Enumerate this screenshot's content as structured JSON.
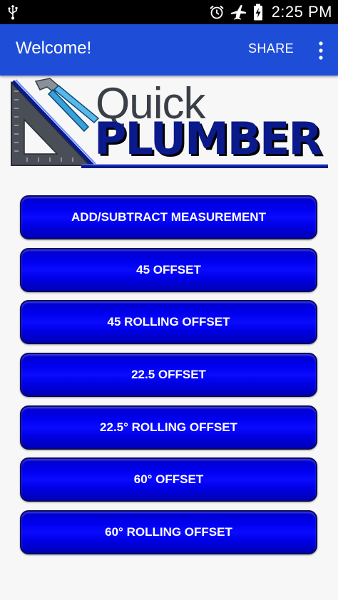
{
  "status_bar": {
    "time": "2:25 PM",
    "icons": [
      "usb-icon",
      "alarm-icon",
      "airplane-mode-icon",
      "battery-charging-icon"
    ]
  },
  "app_bar": {
    "title": "Welcome!",
    "share_label": "SHARE",
    "overflow_icon": "more-vert-icon",
    "color": "#1e4ed8"
  },
  "logo": {
    "line1": "Quick",
    "line2": "PLUMBER"
  },
  "menu": {
    "button_color": "#0000f0",
    "items": [
      {
        "label": "ADD/SUBTRACT MEASUREMENT"
      },
      {
        "label": "45 OFFSET"
      },
      {
        "label": "45 ROLLING OFFSET"
      },
      {
        "label": "22.5 OFFSET"
      },
      {
        "label": "22.5° ROLLING OFFSET"
      },
      {
        "label": "60° OFFSET"
      },
      {
        "label": "60° ROLLING OFFSET"
      }
    ]
  }
}
